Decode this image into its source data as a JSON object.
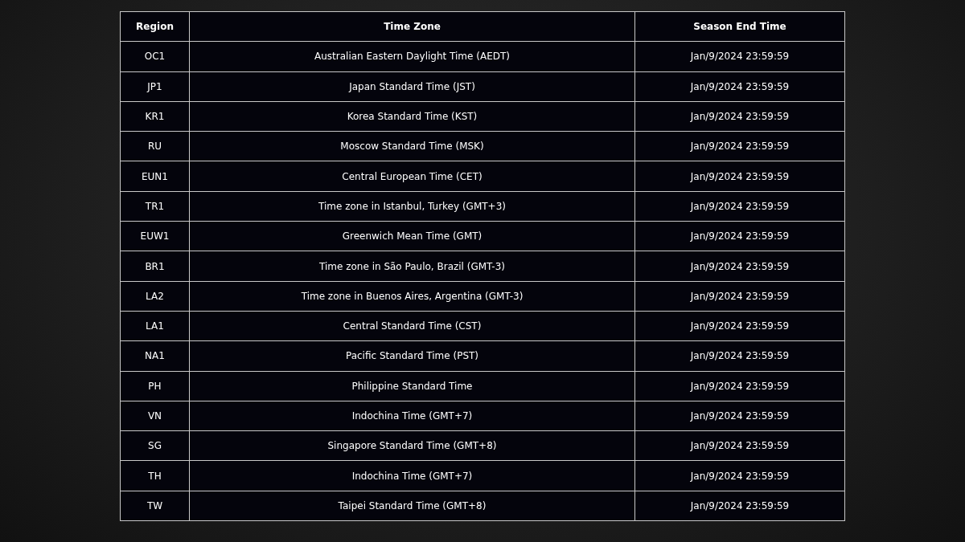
{
  "table": {
    "columns": [
      "Region",
      "Time Zone",
      "Season End Time"
    ],
    "rows": [
      [
        "OC1",
        "Australian Eastern Daylight Time (AEDT)",
        "Jan/9/2024 23:59:59"
      ],
      [
        "JP1",
        "Japan Standard Time (JST)",
        "Jan/9/2024 23:59:59"
      ],
      [
        "KR1",
        "Korea Standard Time (KST)",
        "Jan/9/2024 23:59:59"
      ],
      [
        "RU",
        "Moscow Standard Time (MSK)",
        "Jan/9/2024 23:59:59"
      ],
      [
        "EUN1",
        "Central European Time (CET)",
        "Jan/9/2024 23:59:59"
      ],
      [
        "TR1",
        "Time zone in Istanbul, Turkey (GMT+3)",
        "Jan/9/2024 23:59:59"
      ],
      [
        "EUW1",
        "Greenwich Mean Time (GMT)",
        "Jan/9/2024 23:59:59"
      ],
      [
        "BR1",
        "Time zone in São Paulo, Brazil (GMT-3)",
        "Jan/9/2024 23:59:59"
      ],
      [
        "LA2",
        "Time zone in Buenos Aires, Argentina (GMT-3)",
        "Jan/9/2024 23:59:59"
      ],
      [
        "LA1",
        "Central Standard Time (CST)",
        "Jan/9/2024 23:59:59"
      ],
      [
        "NA1",
        "Pacific Standard Time (PST)",
        "Jan/9/2024 23:59:59"
      ],
      [
        "PH",
        "Philippine Standard Time",
        "Jan/9/2024 23:59:59"
      ],
      [
        "VN",
        "Indochina Time (GMT+7)",
        "Jan/9/2024 23:59:59"
      ],
      [
        "SG",
        "Singapore Standard Time (GMT+8)",
        "Jan/9/2024 23:59:59"
      ],
      [
        "TH",
        "Indochina Time (GMT+7)",
        "Jan/9/2024 23:59:59"
      ],
      [
        "TW",
        "Taipei Standard Time (GMT+8)",
        "Jan/9/2024 23:59:59"
      ]
    ]
  }
}
